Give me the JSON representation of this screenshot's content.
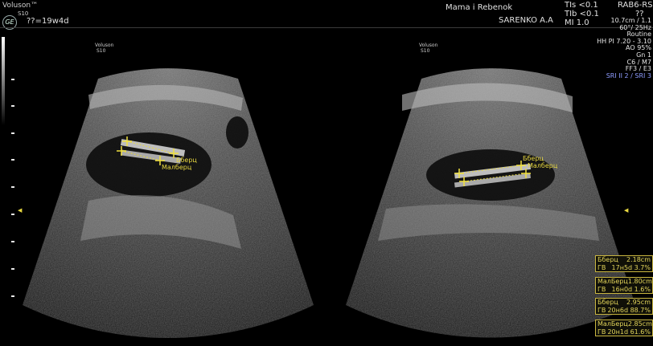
{
  "header": {
    "brand": "Voluson™",
    "brand_sub": "S10",
    "ge_logo": "GE",
    "gestational_age": "??=19w4d",
    "institution": "Mama i Rebenok",
    "operator": "SARENKO A.A",
    "tis": "TIs <0.1",
    "tib": "TIb <0.1",
    "mi": "MI  1.0",
    "probe": "RAB6-RS",
    "probe_sub": "??"
  },
  "params": [
    "10.7cm / 1.1",
    "60°/ 25Hz",
    "Routine",
    "HH PI 7.20 - 3.10",
    "AO 95%",
    "Gn  1",
    "C6 / M7",
    "FF3 / E3"
  ],
  "sri": "SRI II 2 / SRI 3",
  "left_image": {
    "brand": "Voluson",
    "brand_sub": "S10",
    "label1": "Бберц",
    "label2": "Малберц"
  },
  "right_image": {
    "brand": "Voluson",
    "brand_sub": "S10",
    "label1": "Бберц",
    "label2": "Малберц"
  },
  "measurements": [
    {
      "name": "Бберц",
      "value": "2.18cm",
      "ga_label": "ГВ",
      "ga": "17н5d 3.7%"
    },
    {
      "name": "МалБерц",
      "value": "1.80cm",
      "ga_label": "ГВ",
      "ga": "16н0d 1.6%"
    },
    {
      "name": "Бберц",
      "value": "2.95cm",
      "ga_label": "ГВ",
      "ga": "20н6d 88.7%"
    },
    {
      "name": "МалБерц",
      "value": "2.85cm",
      "ga_label": "ГВ",
      "ga": "20н1d 61.6%"
    }
  ],
  "colors": {
    "caliper": "#f0e040",
    "sri": "#8e9cff",
    "box_border": "#c9b640"
  }
}
